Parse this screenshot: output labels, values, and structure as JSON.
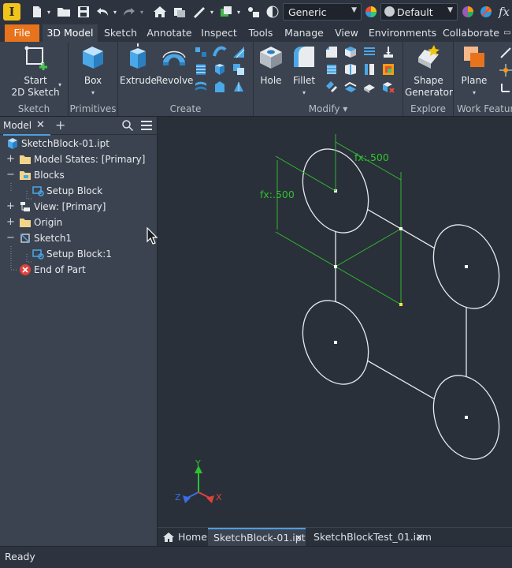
{
  "quick_access": {
    "appearance_value": "Generic",
    "material_value": "Default",
    "fx_label": "fx"
  },
  "tabs": [
    {
      "label": "File"
    },
    {
      "label": "3D Model",
      "active": true
    },
    {
      "label": "Sketch"
    },
    {
      "label": "Annotate"
    },
    {
      "label": "Inspect"
    },
    {
      "label": "Tools"
    },
    {
      "label": "Manage"
    },
    {
      "label": "View"
    },
    {
      "label": "Environments"
    },
    {
      "label": "Collaborate"
    }
  ],
  "ribbon": {
    "sketch_panel": {
      "title": "Sketch",
      "start_label_1": "Start",
      "start_label_2": "2D Sketch"
    },
    "primitives_panel": {
      "title": "Primitives",
      "box_label": "Box"
    },
    "create_panel": {
      "title": "Create",
      "extrude_label": "Extrude",
      "revolve_label": "Revolve"
    },
    "modify_panel": {
      "title": "Modify ▾",
      "hole_label": "Hole",
      "fillet_label": "Fillet"
    },
    "explore_panel": {
      "title": "Explore",
      "shape_label_1": "Shape",
      "shape_label_2": "Generator"
    },
    "work_panel": {
      "title": "Work Feature",
      "plane_label": "Plane"
    }
  },
  "browser": {
    "tab_label": "Model",
    "tree": [
      {
        "label": "SketchBlock-01.ipt"
      },
      {
        "label": "Model States: [Primary]"
      },
      {
        "label": "Blocks"
      },
      {
        "label": "Setup Block"
      },
      {
        "label": "View: [Primary]"
      },
      {
        "label": "Origin"
      },
      {
        "label": "Sketch1"
      },
      {
        "label": "Setup Block:1"
      },
      {
        "label": "End of Part"
      }
    ]
  },
  "viewport": {
    "dim_top": "fx:.500",
    "dim_left": "fx:.500",
    "axis_y": "Y",
    "axis_z": "Z",
    "axis_x": "X"
  },
  "doc_tabs": [
    {
      "label": "Home"
    },
    {
      "label": "SketchBlock-01.ipt",
      "active": true
    },
    {
      "label": "SketchBlockTest_01.iam"
    }
  ],
  "status": {
    "text": "Ready"
  },
  "colors": {
    "file_tab": "#e8731d",
    "dimension_green": "#2fc22f",
    "viewport_bg": "#2a3039",
    "panel_bg": "#3b4350"
  }
}
